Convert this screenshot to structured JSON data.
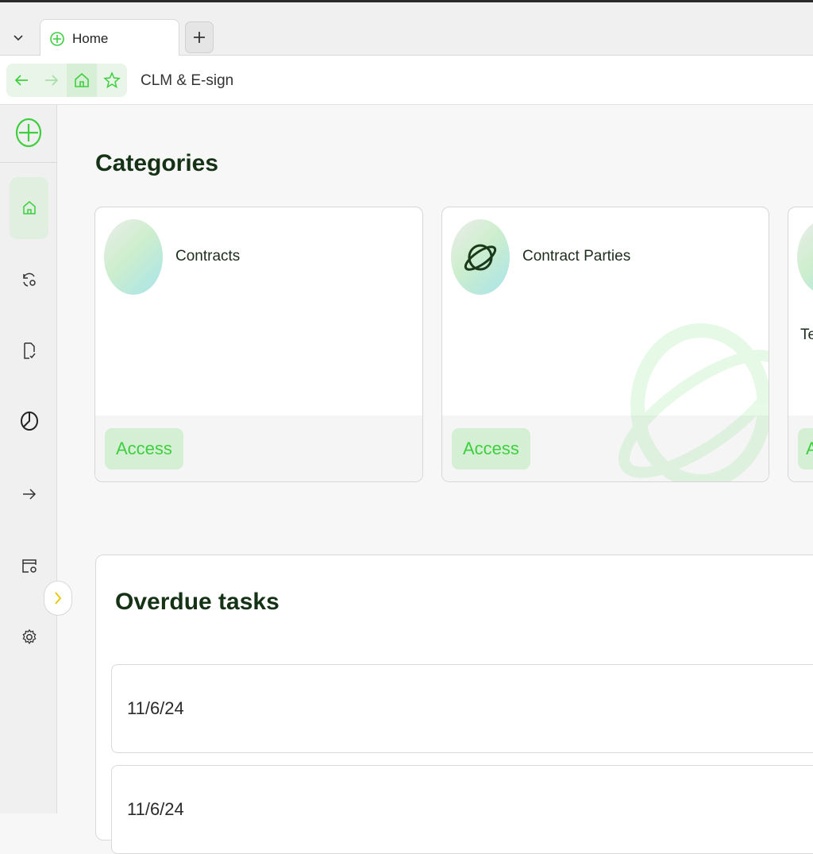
{
  "browser": {
    "tab_title": "Home",
    "address_title": "CLM & E-sign"
  },
  "main": {
    "categories_title": "Categories",
    "categories": [
      {
        "label": "Contracts",
        "action": "Access"
      },
      {
        "label": "Contract Parties",
        "action": "Access"
      },
      {
        "label": "Te",
        "action": "A"
      }
    ],
    "overdue": {
      "title": "Overdue tasks",
      "tasks": [
        {
          "date": "11/6/24"
        },
        {
          "date": "11/6/24"
        }
      ]
    }
  },
  "icons": {
    "logo": "plus-circle-icon",
    "sidebar": [
      "home-icon",
      "sync-settings-icon",
      "document-check-icon",
      "pie-chart-icon",
      "arrow-right-icon",
      "calendar-settings-icon",
      "gear-icon"
    ]
  },
  "colors": {
    "accent": "#3ecf3e",
    "accent_soft": "#d4efd4",
    "title_text": "#163216"
  }
}
